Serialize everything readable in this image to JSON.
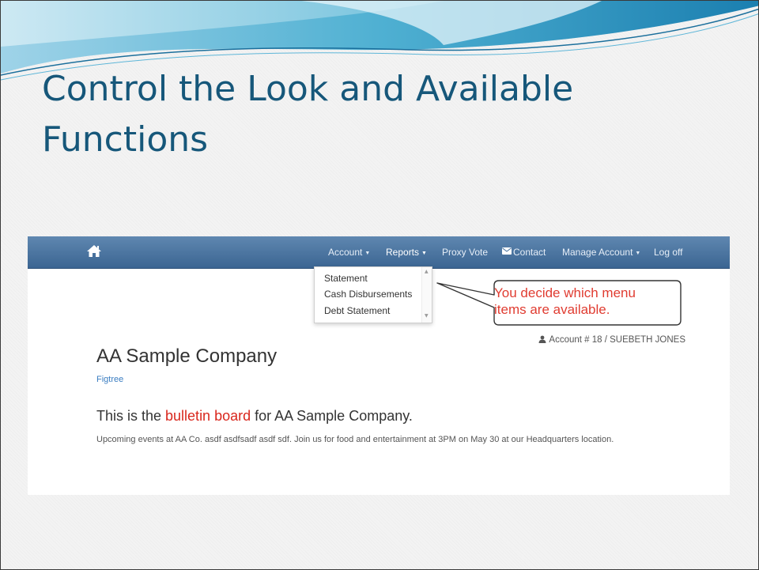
{
  "slide": {
    "title_line1": "Control the Look and Available",
    "title_line2": "Functions"
  },
  "navbar": {
    "home_icon": "home-icon",
    "items": [
      {
        "label": "Account",
        "has_caret": true
      },
      {
        "label": "Reports",
        "has_caret": true,
        "active": true
      },
      {
        "label": "Proxy Vote"
      },
      {
        "label": "Contact",
        "icon": "envelope-icon"
      },
      {
        "label": "Manage Account",
        "has_caret": true
      },
      {
        "label": "Log off"
      }
    ],
    "caret_glyph": "▼"
  },
  "reports_dropdown": {
    "items": [
      "Statement",
      "Cash Disbursements",
      "Debt Statement"
    ]
  },
  "callout": {
    "line1": "You decide which menu",
    "line2": "items are available."
  },
  "account": {
    "text": "Account # 18 / SUEBETH JONES",
    "icon": "user-icon"
  },
  "company": {
    "name": "AA Sample Company",
    "link": "Figtree"
  },
  "bulletin": {
    "prefix": "This is the ",
    "highlight": "bulletin board",
    "suffix": " for AA Sample Company.",
    "body": "Upcoming events at AA Co.  asdf asdfsadf  asdf sdf.  Join us for food and entertainment at 3PM on May 30 at our Headquarters location."
  },
  "colors": {
    "title": "#16577a",
    "navbar": "#4a74a0",
    "highlight": "#d9271d",
    "link": "#3a7dc1",
    "callout_text": "#e03c31"
  }
}
